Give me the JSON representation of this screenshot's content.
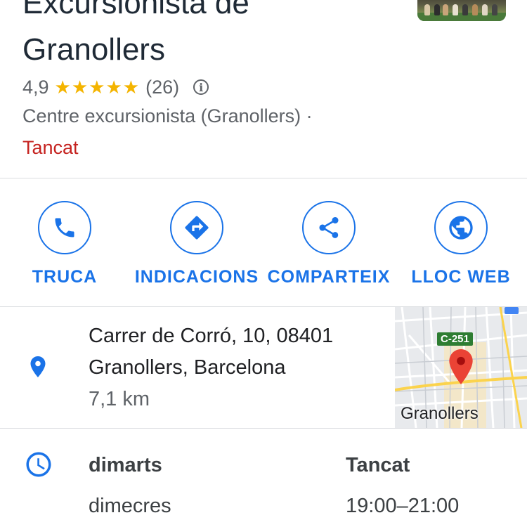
{
  "place": {
    "title_line1": "Excursionista de",
    "title_line2": "Granollers",
    "rating": "4,9",
    "stars": "★★★★★",
    "review_count": "(26)",
    "info_icon": "info-icon",
    "category": "Centre excursionista (Granollers) ·",
    "open_status": "Tancat"
  },
  "actions": [
    {
      "label": "TRUCA",
      "icon": "phone-icon"
    },
    {
      "label": "INDICACIONS",
      "icon": "directions-icon"
    },
    {
      "label": "COMPARTEIX",
      "icon": "share-icon"
    },
    {
      "label": "LLOC WEB",
      "icon": "globe-icon"
    }
  ],
  "address": {
    "line1": "Carrer de Corró, 10, 08401",
    "line2": "Granollers, Barcelona",
    "distance": "7,1 km",
    "icon": "location-pin-icon"
  },
  "map": {
    "city_label": "Granollers",
    "road_label": "C-251"
  },
  "hours": {
    "icon": "clock-icon",
    "rows": [
      {
        "day": "dimarts",
        "value": "Tancat"
      },
      {
        "day": "dimecres",
        "value": "19:00–21:00"
      }
    ]
  },
  "colors": {
    "accent": "#1a73e8",
    "closed": "#c5221f",
    "star": "#f4b400",
    "text_secondary": "#5f6368"
  }
}
